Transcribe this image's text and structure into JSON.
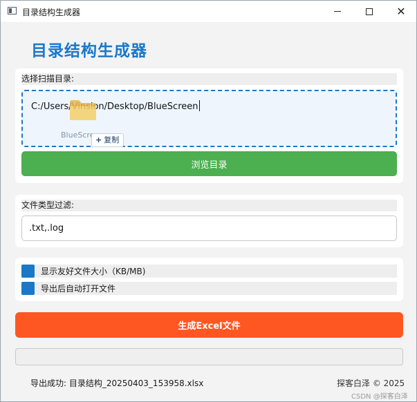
{
  "window": {
    "title": "目录结构生成器",
    "minimize_glyph": "—",
    "maximize_glyph": "☐",
    "close_glyph": "✕"
  },
  "heading": "目录结构生成器",
  "directory": {
    "label": "选择扫描目录:",
    "path": "C:/Users/Vinsion/Desktop/BlueScreen",
    "drag_name": "BlueScre",
    "copy_tip": "复制",
    "copy_plus": "+",
    "browse_label": "浏览目录"
  },
  "filter": {
    "label": "文件类型过滤:",
    "value": ".txt,.log"
  },
  "options": [
    {
      "label": "显示友好文件大小（KB/MB)",
      "checked": true
    },
    {
      "label": "导出后自动打开文件",
      "checked": true
    }
  ],
  "generate_label": "生成Excel文件",
  "progress": {
    "value": 0
  },
  "status": "导出成功: 目录结构_20250403_153958.xlsx",
  "copyright": "探客白泽 © 2025",
  "watermark": "CSDN @探客白泽",
  "colors": {
    "accent": "#1a78c9",
    "browse": "#4caf50",
    "generate": "#ff5722"
  },
  "icons": {
    "app": "app-window-icon",
    "folder": "folder-icon",
    "checkbox": "checkbox-checked-icon"
  }
}
